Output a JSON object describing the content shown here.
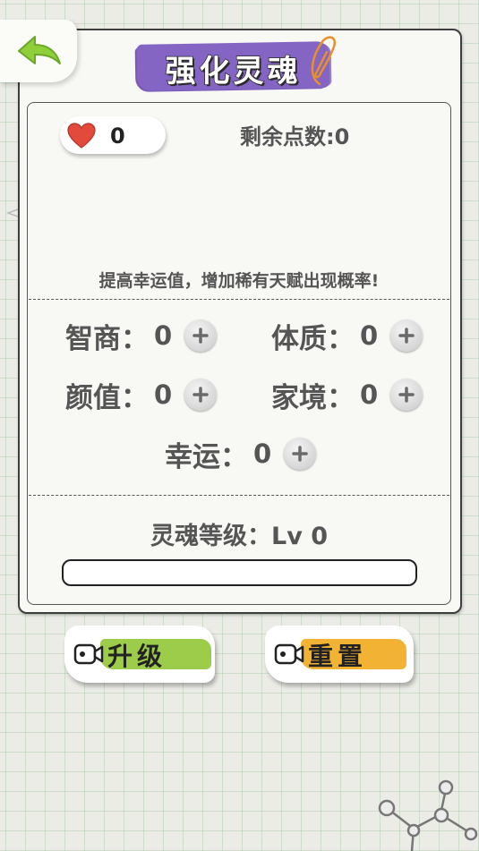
{
  "title": "强化灵魂",
  "hearts": {
    "count": "0"
  },
  "points": {
    "label": "剩余点数",
    "sep": ":",
    "value": "0"
  },
  "hint": "提高幸运值，增加稀有天赋出现概率!",
  "attributes": [
    {
      "label": "智商",
      "value": "0"
    },
    {
      "label": "体质",
      "value": "0"
    },
    {
      "label": "颜值",
      "value": "0"
    },
    {
      "label": "家境",
      "value": "0"
    },
    {
      "label": "幸运",
      "value": "0"
    }
  ],
  "attr_sep": "：",
  "soul": {
    "text": "灵魂等级：Lv 0",
    "progress": 0
  },
  "buttons": {
    "upgrade": "升级",
    "reset": "重置"
  },
  "colors": {
    "title_brush": "#8465c4",
    "upgrade_brush": "#9ccc4a",
    "reset_brush": "#f2b233",
    "heart": "#e24a3b",
    "back_arrow": "#8fcf3a"
  },
  "icons": {
    "back": "back-arrow-icon",
    "heart": "heart-icon",
    "plus": "plus-icon",
    "video": "video-camera-icon"
  }
}
